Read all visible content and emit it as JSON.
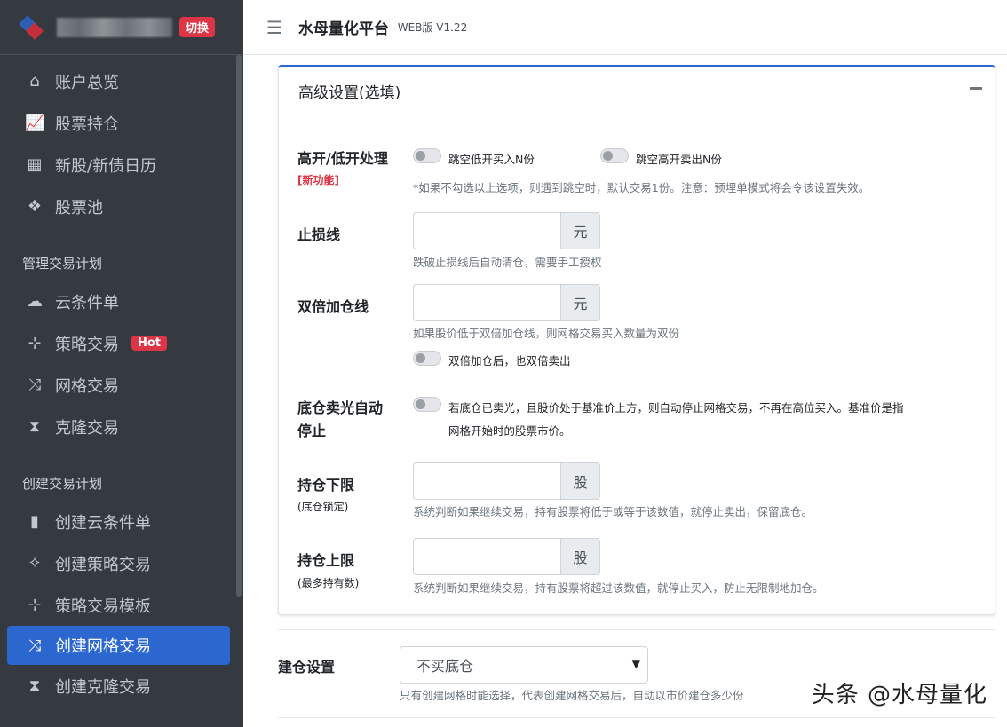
{
  "brand": {
    "switch_label": "切换"
  },
  "sidebar": {
    "top_items": [
      {
        "label": "账户总览",
        "icon": "home-icon"
      },
      {
        "label": "股票持仓",
        "icon": "chart-line-icon"
      },
      {
        "label": "新股/新债日历",
        "icon": "calendar-icon"
      },
      {
        "label": "股票池",
        "icon": "cubes-icon"
      }
    ],
    "section1": "管理交易计划",
    "manage_items": [
      {
        "label": "云条件单",
        "icon": "cloud-icon"
      },
      {
        "label": "策略交易",
        "icon": "sitemap-icon",
        "badge": "Hot"
      },
      {
        "label": "网格交易",
        "icon": "random-icon"
      },
      {
        "label": "克隆交易",
        "icon": "hourglass-icon"
      }
    ],
    "section2": "创建交易计划",
    "create_items": [
      {
        "label": "创建云条件单",
        "icon": "file-icon"
      },
      {
        "label": "创建策略交易",
        "icon": "magic-icon"
      },
      {
        "label": "策略交易模板",
        "icon": "sitemap-icon"
      },
      {
        "label": "创建网格交易",
        "icon": "random-icon",
        "active": true
      },
      {
        "label": "创建克隆交易",
        "icon": "hourglass-icon"
      }
    ]
  },
  "header": {
    "title": "水母量化平台",
    "version": "-WEB版 V1.22"
  },
  "advanced": {
    "title": "高级设置(选填)",
    "gap": {
      "label": "高开/低开处理",
      "new_tag": "[新功能]",
      "toggle_low": "跳空低开买入N份",
      "toggle_high": "跳空高开卖出N份",
      "help": "*如果不勾选以上选项，则遇到跳空时，默认交易1份。注意：预埋单模式将会令该设置失效。"
    },
    "stop_loss": {
      "label": "止损线",
      "unit": "元",
      "help": "跌破止损线后自动清仓，需要手工授权",
      "value": ""
    },
    "double": {
      "label": "双倍加仓线",
      "unit": "元",
      "help": "如果股价低于双倍加仓线，则网格交易买入数量为双份",
      "toggle": "双倍加仓后，也双倍卖出",
      "value": ""
    },
    "auto_stop": {
      "label_line1": "底仓卖光自动",
      "label_line2": "停止",
      "text_line1": "若底仓已卖光，且股价处于基准价上方，则自动停止网格交易，不再在高位买入。基准价是指",
      "text_line2": "网格开始时的股票市价。"
    },
    "min_pos": {
      "label": "持仓下限",
      "sub": "(底仓锁定)",
      "unit": "股",
      "help": "系统判断如果继续交易，持有股票将低于或等于该数值，就停止卖出，保留底仓。",
      "value": ""
    },
    "max_pos": {
      "label": "持仓上限",
      "sub": "(最多持有数)",
      "unit": "股",
      "help": "系统判断如果继续交易，持有股票将超过该数值，就停止买入，防止无限制地加仓。",
      "value": ""
    }
  },
  "build": {
    "label": "建仓设置",
    "selected": "不买底仓",
    "help": "只有创建网格时能选择，代表创建网格交易后，自动以市价建仓多少份"
  },
  "watermark": "头条 @水母量化"
}
